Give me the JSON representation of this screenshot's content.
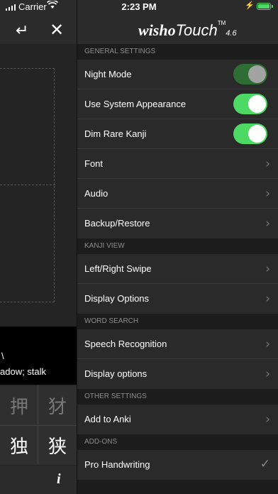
{
  "status_bar": {
    "carrier": "Carrier",
    "time": "2:23 PM"
  },
  "left_panel": {
    "entry_line1": "\\",
    "entry_line2": "adow; stalk",
    "kanji": [
      "押",
      "犲",
      "独",
      "狭"
    ]
  },
  "app": {
    "brand": "wisho",
    "brand2": "Touch",
    "tm": "TM",
    "version": "4.6"
  },
  "settings": {
    "general_header": "GENERAL SETTINGS",
    "night_mode": "Night Mode",
    "use_system_appearance": "Use System Appearance",
    "dim_rare_kanji": "Dim Rare Kanji",
    "font": "Font",
    "audio": "Audio",
    "backup_restore": "Backup/Restore",
    "kanji_view_header": "KANJI VIEW",
    "left_right_swipe": "Left/Right Swipe",
    "display_options": "Display Options",
    "word_search_header": "WORD SEARCH",
    "speech_recognition": "Speech Recognition",
    "display_options_2": "Display options",
    "other_settings_header": "OTHER SETTINGS",
    "add_to_anki": "Add to Anki",
    "addons_header": "ADD-ONS",
    "pro_handwriting": "Pro Handwriting"
  },
  "toggles": {
    "night_mode": true,
    "use_system_appearance": true,
    "dim_rare_kanji": true
  },
  "colors": {
    "toggle_on": "#4cd964",
    "toggle_disabled": "#2e6e35",
    "background": "#1c1c1c"
  },
  "icons": {
    "return": "return-icon",
    "close": "close-icon",
    "info": "info-icon",
    "chevron": "chevron-right-icon",
    "check": "checkmark-icon"
  }
}
